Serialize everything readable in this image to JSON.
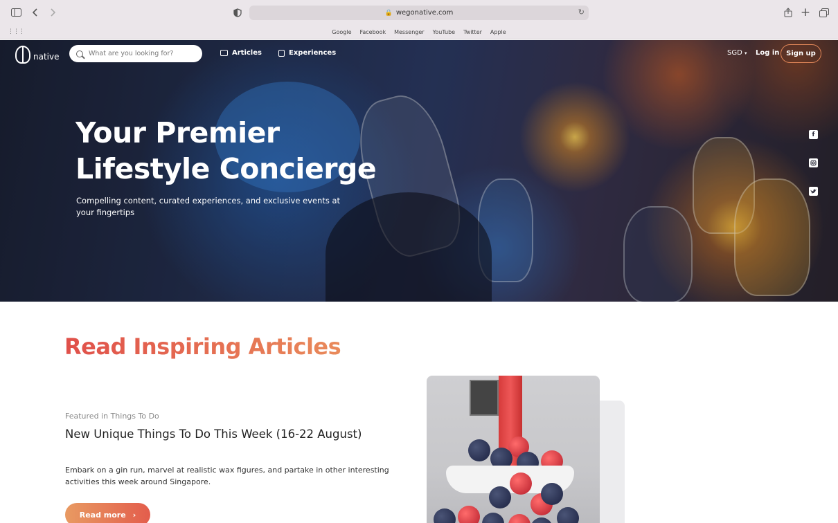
{
  "browser": {
    "url": "wegonative.com",
    "favorites": [
      "Google",
      "Facebook",
      "Messenger",
      "YouTube",
      "Twitter",
      "Apple"
    ]
  },
  "nav": {
    "logo_text": "native",
    "search_placeholder": "What are you looking for?",
    "links": [
      "Articles",
      "Experiences"
    ],
    "currency": "SGD",
    "login": "Log in",
    "signup": "Sign up"
  },
  "hero": {
    "title_line1": "Your Premier",
    "title_line2": "Lifestyle Concierge",
    "subtitle": "Compelling content, curated experiences, and exclusive events at your fingertips",
    "social_icons": [
      "facebook-icon",
      "instagram-icon",
      "twitter-icon"
    ]
  },
  "articles": {
    "section_title": "Read Inspiring Articles",
    "featured_label": "Featured in Things To Do",
    "title": "New Unique Things To Do This Week (16-22 August)",
    "description": "Embark on a gin run, marvel at realistic wax figures, and partake in other interesting activities this week around Singapore.",
    "button": "Read more"
  },
  "colors": {
    "accent_start": "#e0504a",
    "accent_end": "#e98a5a"
  }
}
